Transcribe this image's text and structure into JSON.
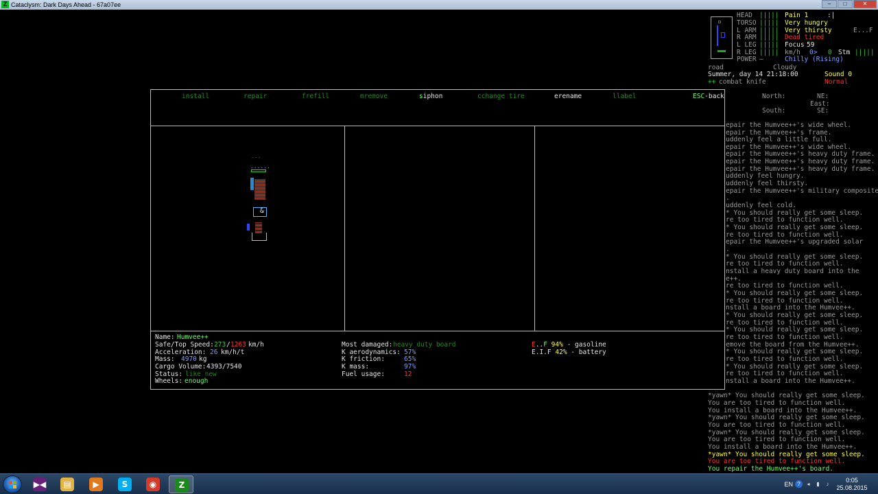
{
  "window": {
    "title": "Cataclysm: Dark Days Ahead - 67a07ee",
    "app_icon": "Z",
    "buttons": [
      "–",
      "□",
      "✕"
    ]
  },
  "status": {
    "body_parts": [
      {
        "label": "HEAD",
        "bar": "|||||"
      },
      {
        "label": "TORSO",
        "bar": "|||||"
      },
      {
        "label": "L ARM",
        "bar": "|||||"
      },
      {
        "label": "R ARM",
        "bar": "|||||"
      },
      {
        "label": "L LEG",
        "bar": "|||||"
      },
      {
        "label": "R LEG",
        "bar": "|||||"
      },
      {
        "label": "POWER",
        "bar": "—"
      }
    ],
    "conditions": {
      "pain": "Pain 1",
      "hunger": "Very hungry",
      "thirst": "Very thirsty",
      "fatigue": "Dead tired",
      "focus_label": "Focus",
      "focus_value": "59",
      "speed_label": "km/h",
      "speed_value": "0>",
      "speed_zero": "0",
      "stamina_label": "Stm",
      "stamina_bar": "|||||",
      "temperature": "Chilly (Rising)"
    },
    "side_marks": {
      "top": ":|",
      "fuel": "E...F"
    },
    "terrain": "road",
    "weather": "Cloudy",
    "date_time": "Summer, day 14 21:18:00",
    "sound": "Sound 0",
    "weapon_prefix": "++",
    "weapon": "combat knife",
    "movement": "Normal"
  },
  "compass": {
    "north": "North:",
    "ne": "NE:",
    "east": "East:",
    "south": "South:",
    "se": "SE:"
  },
  "menu": [
    {
      "key": "i",
      "rest": "nstall",
      "enabled": false
    },
    {
      "key": "r",
      "rest": "epair",
      "enabled": false
    },
    {
      "key": "f",
      "rest": "refill",
      "enabled": false
    },
    {
      "key": "m",
      "rest": "remove",
      "enabled": false
    },
    {
      "key": "s",
      "rest": "iphon",
      "enabled": true
    },
    {
      "key": "c",
      "rest": "change tire",
      "enabled": false
    },
    {
      "key": "e",
      "rest": "rename",
      "enabled": true
    },
    {
      "key": "l",
      "rest": "label",
      "enabled": false
    }
  ],
  "esc": {
    "key": "ESC",
    "rest": "-back"
  },
  "vehicle_glyphs": {
    "front": "---",
    "bar": "......",
    "seat": "&"
  },
  "vehicle_info": {
    "name_label": "Name:",
    "name": "Humvee++",
    "speed_label": "Safe/Top Speed:",
    "safe_speed": "273",
    "top_speed": "1263",
    "speed_unit": "km/h",
    "accel_label": "Acceleration:",
    "accel": "26",
    "accel_unit": "km/h/t",
    "mass_label": "Mass:",
    "mass": "4970",
    "mass_unit": "kg",
    "cargo_label": "Cargo Volume:",
    "cargo": "4393/7540",
    "status_label": "Status:",
    "status": "like new",
    "wheels_label": "Wheels:",
    "wheels": "enough",
    "damaged_label": "Most damaged:",
    "damaged": "heavy duty board",
    "aero_label": "K aerodynamics:",
    "aero": "57%",
    "friction_label": "K friction:",
    "friction": "65%",
    "kmass_label": "K mass:",
    "kmass": "97%",
    "fuel_label": "Fuel usage:",
    "fuel": "12",
    "tanks": [
      {
        "gauge_e": "E",
        "gauge_dots": "..",
        "gauge_f": "F",
        "percent": "94%",
        "name": "- gasoline"
      },
      {
        "gauge_e": "E",
        "gauge_dots": ".I.",
        "gauge_f": "F",
        "percent": "42%",
        "name": "- battery"
      }
    ]
  },
  "messages_right": [
    "epair the Humvee++'s wide wheel.",
    "epair the Humvee++'s frame.",
    "uddenly feel a little full.",
    "epair the Humvee++'s wide wheel.",
    "epair the Humvee++'s heavy duty frame.",
    "epair the Humvee++'s heavy duty frame.",
    "epair the Humvee++'s heavy duty frame.",
    "uddenly feel hungry.",
    "uddenly feel thirsty.",
    "epair the Humvee++'s military composite",
    ".",
    "uddenly feel cold.",
    "* You should really get some sleep.",
    "re too tired to function well.",
    "* You should really get some sleep.",
    "re too tired to function well.",
    "epair the Humvee++'s upgraded solar",
    ".",
    "* You should really get some sleep.",
    "re too tired to function well.",
    "nstall a heavy duty board into the",
    "e++.",
    "re too tired to function well.",
    "* You should really get some sleep.",
    "re too tired to function well.",
    "nstall a board into the Humvee++.",
    "* You should really get some sleep.",
    "re too tired to function well.",
    "* You should really get some sleep.",
    "re too tired to function well.",
    "emove the board from the Humvee++.",
    "* You should really get some sleep.",
    "re too tired to function well.",
    "* You should really get some sleep.",
    "re too tired to function well.",
    "nstall a board into the Humvee++."
  ],
  "messages_bottom": [
    {
      "text": "*yawn* You should really get some sleep.",
      "style": "gray"
    },
    {
      "text": "You are too tired to function well.",
      "style": "gray"
    },
    {
      "text": "You install a board into the Humvee++.",
      "style": "gray"
    },
    {
      "text": "*yawn* You should really get some sleep.",
      "style": "gray"
    },
    {
      "text": "You are too tired to function well.",
      "style": "gray"
    },
    {
      "text": "*yawn* You should really get some sleep.",
      "style": "gray"
    },
    {
      "text": "You are too tired to function well.",
      "style": "gray"
    },
    {
      "text": "You install a board into the Humvee++.",
      "style": "gray"
    },
    {
      "text": "*yawn* You should really get some sleep.",
      "style": "yellow"
    },
    {
      "text": "You are too tired to function well.",
      "style": "red"
    },
    {
      "text": "You repair the Humvee++'s board.",
      "style": "green"
    }
  ],
  "taskbar": {
    "apps": [
      {
        "name": "visual-studio",
        "glyph": "▶◀",
        "color": "#68217a"
      },
      {
        "name": "folder",
        "glyph": "▤",
        "color": "#e0b446"
      },
      {
        "name": "media-player",
        "glyph": "▶",
        "color": "#e07a1f"
      },
      {
        "name": "skype",
        "glyph": "S",
        "color": "#00aff0"
      },
      {
        "name": "chrome",
        "glyph": "◉",
        "color": "#d33b2c"
      },
      {
        "name": "cataclysm",
        "glyph": "Z",
        "color": "#1a8a1a"
      }
    ],
    "language": "EN",
    "tray_icons": [
      "?",
      "◂",
      "▮",
      "♪"
    ],
    "time": "0:05",
    "date": "25.08.2015"
  }
}
